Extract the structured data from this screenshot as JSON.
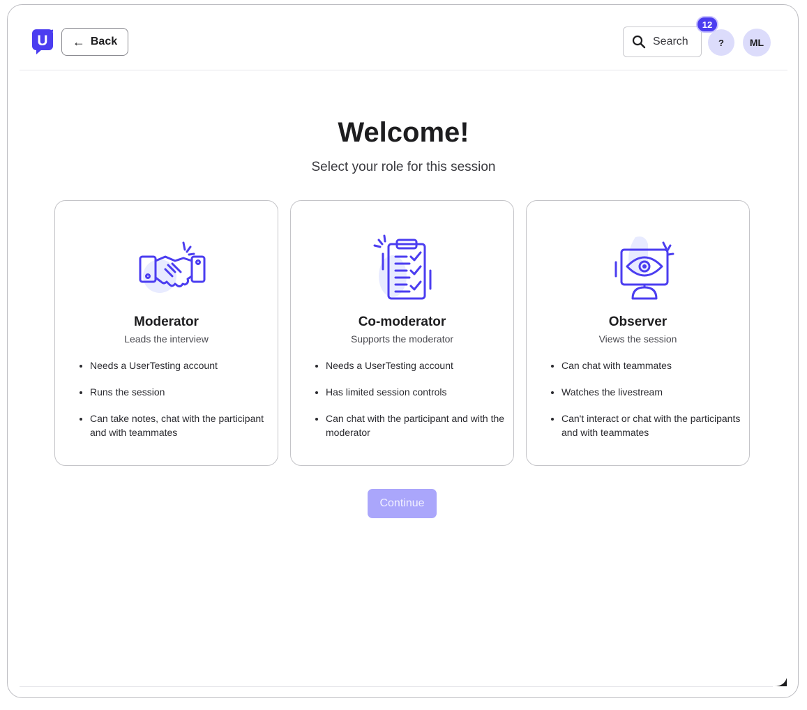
{
  "header": {
    "logo_letter": "U",
    "back_label": "Back",
    "search_label": "Search",
    "help_label": "?",
    "notification_count": "12",
    "avatar_initials": "ML"
  },
  "main": {
    "title": "Welcome!",
    "subtitle": "Select your role for this session",
    "continue_label": "Continue"
  },
  "roles": [
    {
      "name": "Moderator",
      "description": "Leads the interview",
      "icon": "handshake-icon",
      "bullets": [
        "Needs a UserTesting account",
        "Runs the session",
        "Can take notes, chat with the participant and with teammates"
      ]
    },
    {
      "name": "Co-moderator",
      "description": "Supports the moderator",
      "icon": "clipboard-checklist-icon",
      "bullets": [
        "Needs a UserTesting account",
        "Has limited session controls",
        "Can chat with the participant and with the moderator"
      ]
    },
    {
      "name": "Observer",
      "description": "Views the session",
      "icon": "monitor-eye-icon",
      "bullets": [
        "Can chat with teammates",
        "Watches the livestream",
        "Can't interact or chat with the participants and with teammates"
      ]
    }
  ],
  "colors": {
    "brand": "#4b3df0",
    "illustration_bg": "#e8ebff",
    "continue_disabled": "#aaa6fb",
    "avatar_bg": "#dcdcfb"
  }
}
